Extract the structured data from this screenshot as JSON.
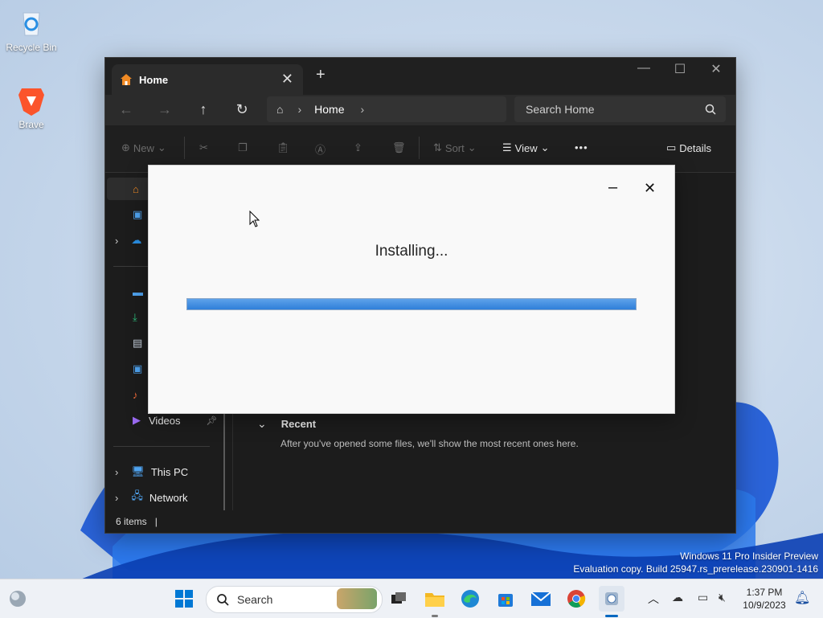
{
  "desktop": {
    "icons": [
      {
        "label": "Recycle Bin"
      },
      {
        "label": "Brave"
      }
    ],
    "watermark": {
      "line1": "Windows 11 Pro Insider Preview",
      "line2": "Evaluation copy. Build 25947.rs_prerelease.230901-1416"
    }
  },
  "explorer": {
    "tab_label": "Home",
    "new_tab_label": "+",
    "breadcrumb": {
      "current": "Home"
    },
    "search": {
      "placeholder": "Search Home"
    },
    "toolbar": {
      "new_label": "New",
      "sort_label": "Sort",
      "view_label": "View",
      "more_label": "•••",
      "details_label": "Details"
    },
    "sidebar": {
      "videos_label": "Videos",
      "this_pc_label": "This PC",
      "network_label": "Network"
    },
    "recent": {
      "heading": "Recent",
      "empty_message": "After you've opened some files, we'll show the most recent ones here."
    },
    "status": {
      "item_count": "6 items"
    }
  },
  "installer": {
    "title": "Installing...",
    "progress_fraction": 1.0,
    "minimize_label": "–",
    "close_label": "✕"
  },
  "taskbar": {
    "search_label": "Search",
    "clock_time": "1:37 PM",
    "clock_date": "10/9/2023"
  },
  "colors": {
    "accent": "#0067c0",
    "progress_fill": "#3a8ce3",
    "explorer_bg": "#1c1c1c"
  }
}
